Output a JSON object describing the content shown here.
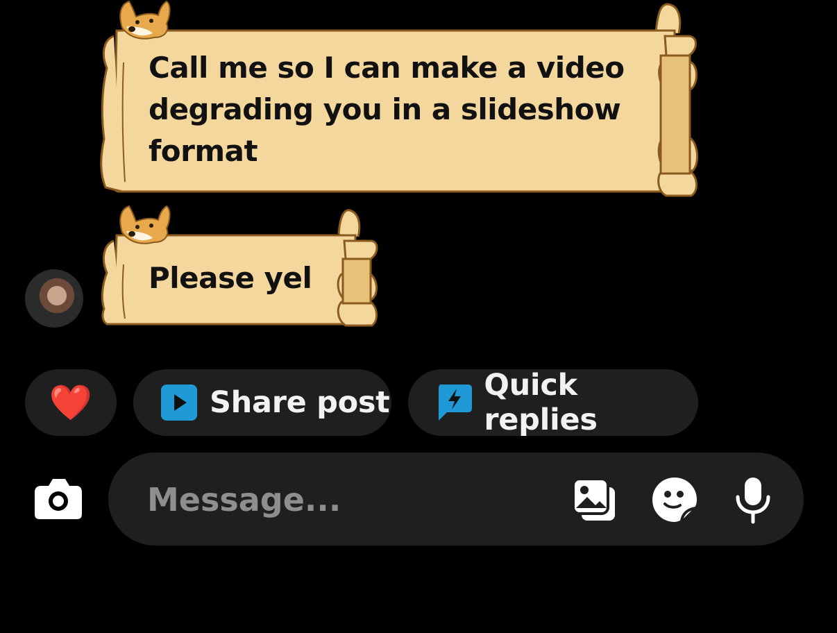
{
  "messages": [
    {
      "text": "Call me so I can make a video degrading you in a slideshow format"
    },
    {
      "text": "Please yel"
    }
  ],
  "quick_actions": {
    "heart_emoji": "❤️",
    "share_post": "Share post",
    "quick_replies": "Quick replies"
  },
  "composer": {
    "placeholder": "Message..."
  },
  "colors": {
    "scroll_fill": "#f3d79c",
    "scroll_edge": "#8a5a1f",
    "accent_blue": "#1f9ad6",
    "chip_bg": "#1f1f1f"
  }
}
